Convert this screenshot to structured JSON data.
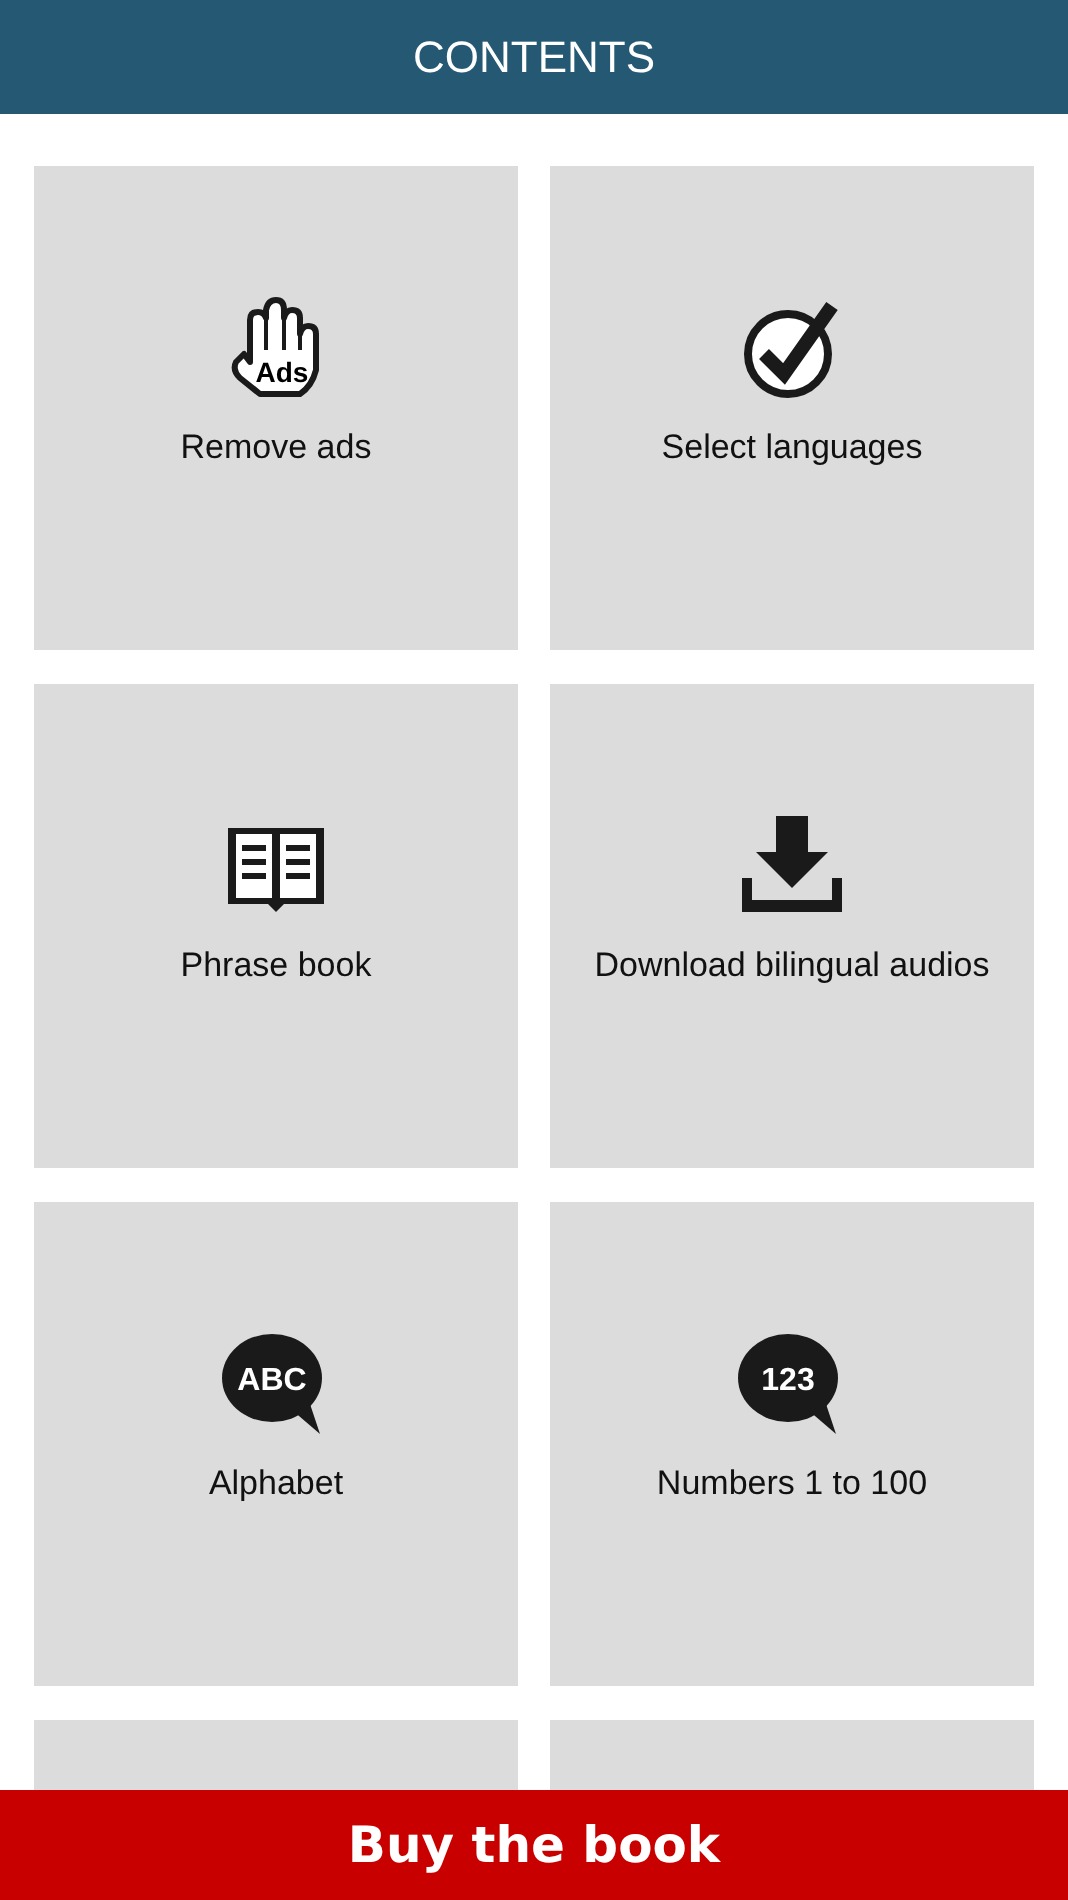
{
  "header": {
    "title": "CONTENTS"
  },
  "tiles": [
    {
      "kind": "hand",
      "icon_text": "Ads",
      "label": "Remove ads"
    },
    {
      "kind": "check",
      "label": "Select languages"
    },
    {
      "kind": "book",
      "label": "Phrase book"
    },
    {
      "kind": "download",
      "label": "Download bilingual audios"
    },
    {
      "kind": "bubble",
      "icon_text": "ABC",
      "label": "Alphabet"
    },
    {
      "kind": "bubble",
      "icon_text": "123",
      "label": "Numbers 1 to 100"
    },
    {
      "kind": "partial"
    },
    {
      "kind": "partial"
    }
  ],
  "footer_button": {
    "label": "Buy the book"
  }
}
